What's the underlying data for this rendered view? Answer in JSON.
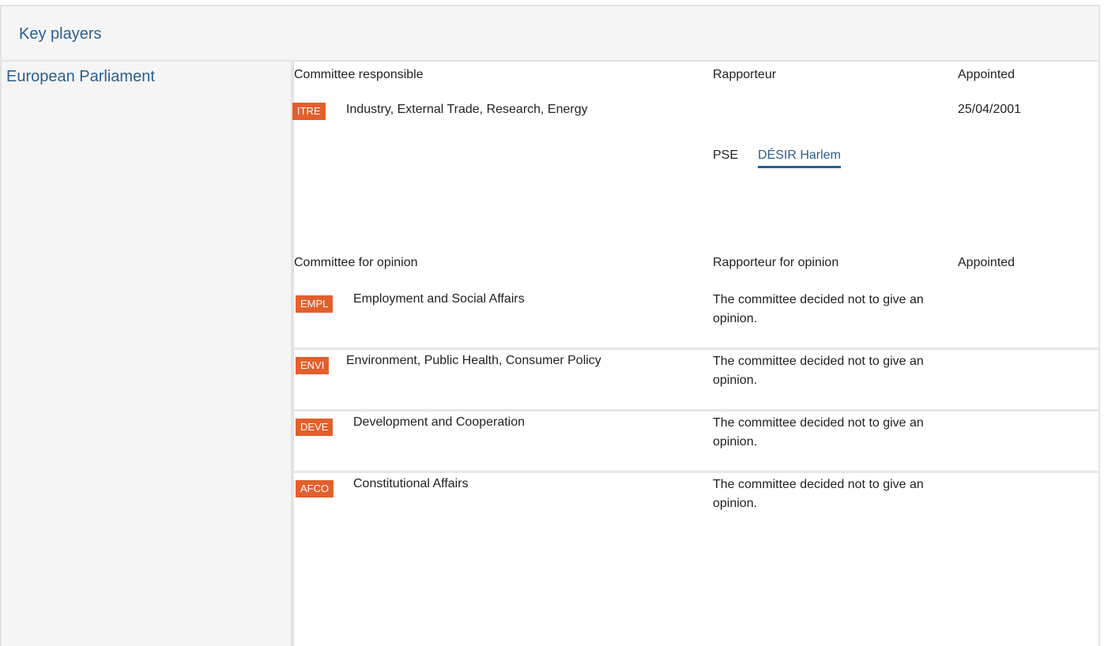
{
  "header": {
    "title": "Key players"
  },
  "institution": {
    "label": "European Parliament"
  },
  "responsible": {
    "col_committee": "Committee responsible",
    "col_rapporteur": "Rapporteur",
    "col_appointed": "Appointed",
    "committee_code": "ITRE",
    "committee_name": "Industry, External Trade, Research, Energy",
    "appointed_date": "25/04/2001",
    "rapporteur_group": "PSE",
    "rapporteur_name": "DÉSIR Harlem"
  },
  "opinion": {
    "col_committee": "Committee for opinion",
    "col_rapporteur": "Rapporteur for opinion",
    "col_appointed": "Appointed",
    "rows": [
      {
        "code": "EMPL",
        "name": "Employment and Social Affairs",
        "rapporteur": "The committee decided not to give an opinion."
      },
      {
        "code": "ENVI",
        "name": "Environment, Public Health, Consumer Policy",
        "rapporteur": "The committee decided not to give an opinion."
      },
      {
        "code": "DEVE",
        "name": "Development and Cooperation",
        "rapporteur": "The committee decided not to give an opinion."
      },
      {
        "code": "AFCO",
        "name": "Constitutional Affairs",
        "rapporteur": "The committee decided not to give an opinion."
      }
    ]
  },
  "colors": {
    "accent": "#2b5f8f",
    "badge": "#e35f2c",
    "panel": "#f5f5f5",
    "border": "#e3e3e3"
  }
}
